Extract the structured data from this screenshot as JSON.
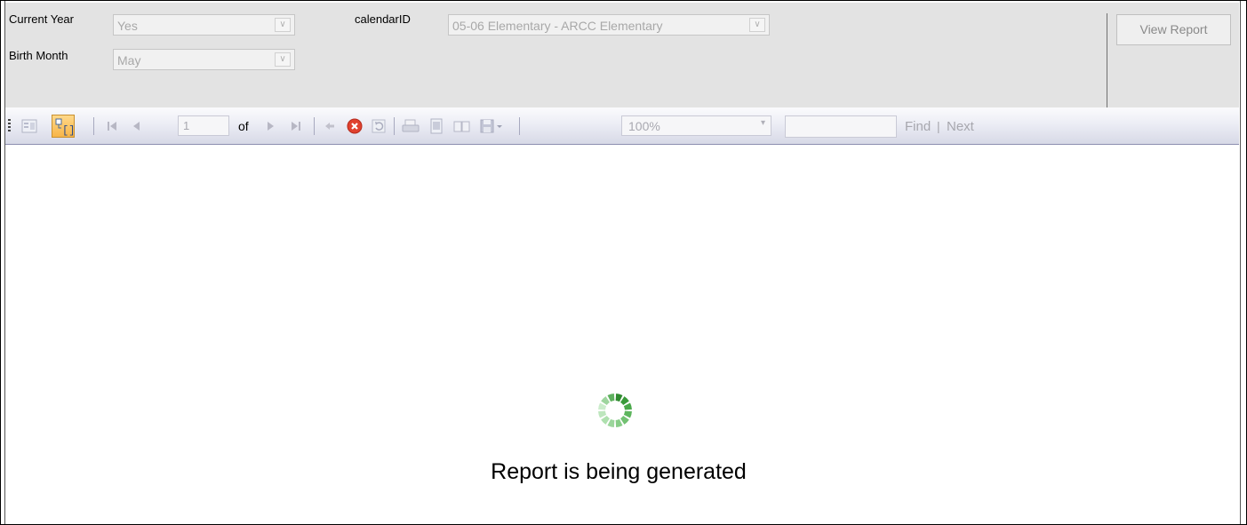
{
  "parameters": {
    "current_year": {
      "label": "Current Year",
      "value": "Yes"
    },
    "birth_month": {
      "label": "Birth Month",
      "value": "May"
    },
    "calendar_id": {
      "label": "calendarID",
      "value": "05-06 Elementary - ARCC Elementary"
    },
    "view_report_label": "View Report"
  },
  "toolbar": {
    "page_number": "1",
    "of_label": "of",
    "zoom": "100%",
    "find_value": "",
    "find_label": "Find",
    "separator": "|",
    "next_label": "Next",
    "icons": [
      "document-map-icon",
      "parameters-toggle-icon",
      "first-page-icon",
      "previous-page-icon",
      "next-page-icon",
      "last-page-icon",
      "back-to-parent-icon",
      "stop-icon",
      "refresh-icon",
      "print-icon",
      "print-layout-icon",
      "page-setup-icon",
      "export-icon"
    ]
  },
  "report": {
    "status_text": "Report is being generated",
    "spinner_color": "#3f9a3f"
  }
}
